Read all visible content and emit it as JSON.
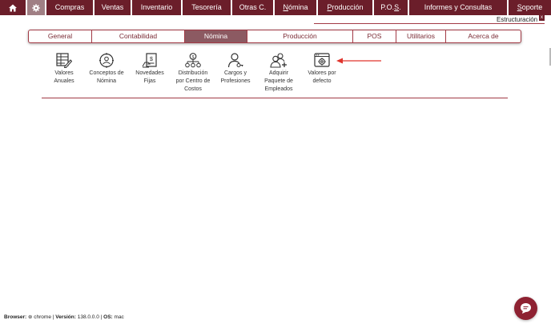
{
  "topbar": {
    "items": [
      {
        "label": "Compras"
      },
      {
        "label": "Ventas"
      },
      {
        "label": "Inventario"
      },
      {
        "label": "Tesorería"
      },
      {
        "label": "Otras C."
      },
      {
        "label_u": "N",
        "label_rest": "ómina"
      },
      {
        "label_u": "P",
        "label_rest": "roducción"
      },
      {
        "label_pre": "P.O.",
        "label_u": "S",
        "label_post": "."
      },
      {
        "label": "Informes y Consultas"
      },
      {
        "label_u": "S",
        "label_rest": "oporte"
      }
    ],
    "home_icon": "home-icon",
    "gear_icon": "gear-icon",
    "bar_color": "#6b1e2a"
  },
  "estructuracion": {
    "title": "Estructuración",
    "close": "x"
  },
  "tabs": [
    {
      "label": "General"
    },
    {
      "label": "Contabilidad"
    },
    {
      "label": "Nómina"
    },
    {
      "label": "Producción"
    },
    {
      "label": "POS"
    },
    {
      "label": "Utilitarios"
    },
    {
      "label": "Acerca de"
    }
  ],
  "active_tab": "Nómina",
  "icons": [
    {
      "icon": "spreadsheet-edit-icon",
      "line1": "Valores",
      "line2": "Anuales",
      "line3": ""
    },
    {
      "icon": "target-person-icon",
      "line1": "Conceptos de",
      "line2": "Nómina",
      "line3": ""
    },
    {
      "icon": "document-money-icon",
      "line1": "Novedades",
      "line2": "Fijas",
      "line3": ""
    },
    {
      "icon": "distribution-tree-icon",
      "line1": "Distribución",
      "line2": "por Centro de",
      "line3": "Costos"
    },
    {
      "icon": "person-key-icon",
      "line1": "Cargos y",
      "line2": "Profesiones",
      "line3": ""
    },
    {
      "icon": "add-users-icon",
      "line1": "Adquirir",
      "line2": "Paquete de",
      "line3": "Empleados"
    },
    {
      "icon": "window-gear-icon",
      "line1": "Valores por",
      "line2": "defecto",
      "line3": ""
    }
  ],
  "footer": {
    "browser_label": "Browser:",
    "browser_value": "chrome",
    "version_label": "Versión:",
    "version_value": "138.0.0.0",
    "os_label": "OS:",
    "os_value": "mac"
  },
  "colors": {
    "brand": "#6b1e2a",
    "accent": "#a23a45",
    "annotation_arrow": "#e0342c"
  }
}
